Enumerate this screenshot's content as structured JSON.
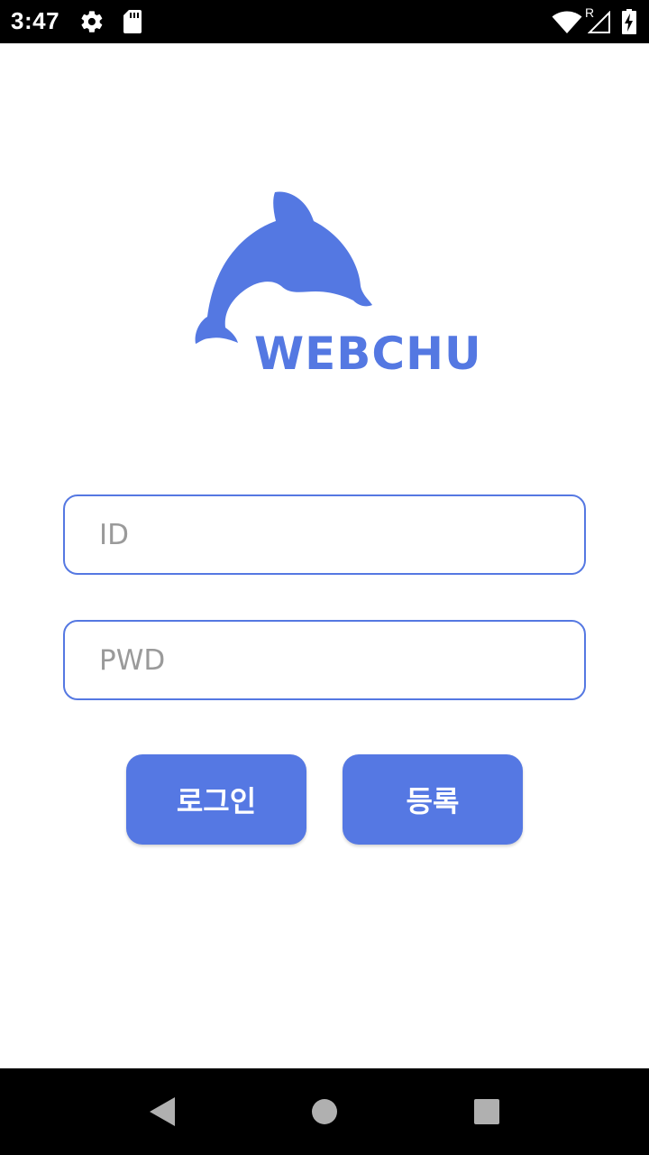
{
  "status_bar": {
    "time": "3:47",
    "icons": [
      "gear-icon",
      "sd-card-icon",
      "wifi-icon",
      "signal-icon",
      "battery-charging-icon"
    ],
    "roaming_indicator": "R"
  },
  "logo": {
    "text": "WEBCHU",
    "icon": "dolphin-icon",
    "color": "#5478e2"
  },
  "form": {
    "id_placeholder": "ID",
    "id_value": "",
    "pwd_placeholder": "PWD",
    "pwd_value": ""
  },
  "buttons": {
    "login_label": "로그인",
    "register_label": "등록",
    "color": "#5578e3"
  },
  "nav_bar": {
    "icons": [
      "back-icon",
      "home-icon",
      "recents-icon"
    ]
  }
}
